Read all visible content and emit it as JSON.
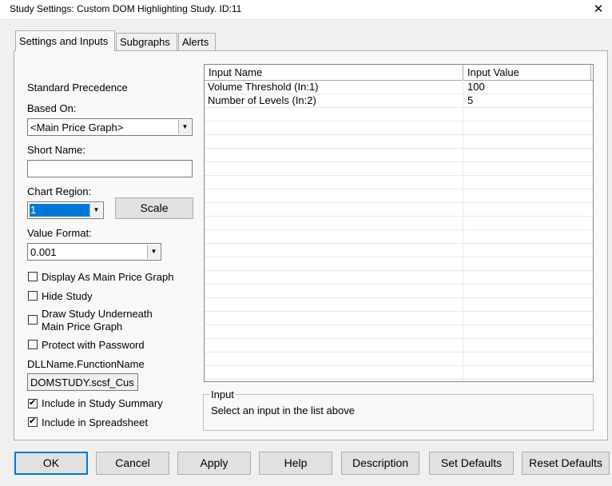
{
  "window": {
    "title": "Study Settings: Custom DOM Highlighting Study. ID:11",
    "close_glyph": "✕"
  },
  "tabs": [
    {
      "label": "Settings and Inputs",
      "active": true
    },
    {
      "label": "Subgraphs",
      "active": false
    },
    {
      "label": "Alerts",
      "active": false
    }
  ],
  "settings": {
    "standard_precedence": "Standard Precedence",
    "based_on_label": "Based On:",
    "based_on_value": "<Main Price Graph>",
    "short_name_label": "Short Name:",
    "short_name_value": "",
    "chart_region_label": "Chart Region:",
    "chart_region_value": "1",
    "scale_button": "Scale",
    "value_format_label": "Value Format:",
    "value_format_value": "0.001",
    "dll_label": "DLLName.FunctionName",
    "dll_value": "DOMSTUDY.scsf_Cus"
  },
  "checkboxes": [
    {
      "label": "Display As Main Price Graph",
      "checked": false
    },
    {
      "label": "Hide Study",
      "checked": false
    },
    {
      "label": "Draw Study Underneath",
      "label2": "Main Price Graph",
      "checked": false
    },
    {
      "label": "Protect with Password",
      "checked": false
    },
    {
      "label": "Include in Study Summary",
      "checked": true
    },
    {
      "label": "Include in Spreadsheet",
      "checked": true
    }
  ],
  "inputs_grid": {
    "columns": [
      "Input Name",
      "Input Value"
    ],
    "rows": [
      {
        "name": "Volume Threshold  (In:1)",
        "value": "100"
      },
      {
        "name": "Number of Levels  (In:2)",
        "value": "5"
      }
    ]
  },
  "input_group": {
    "title": "Input",
    "hint": "Select an input in the list above"
  },
  "buttons": {
    "ok": "OK",
    "cancel": "Cancel",
    "apply": "Apply",
    "help": "Help",
    "description": "Description",
    "set_defaults": "Set Defaults",
    "reset_defaults": "Reset Defaults"
  },
  "colors": {
    "accent": "#0078d7",
    "selection": "#0078d7"
  }
}
